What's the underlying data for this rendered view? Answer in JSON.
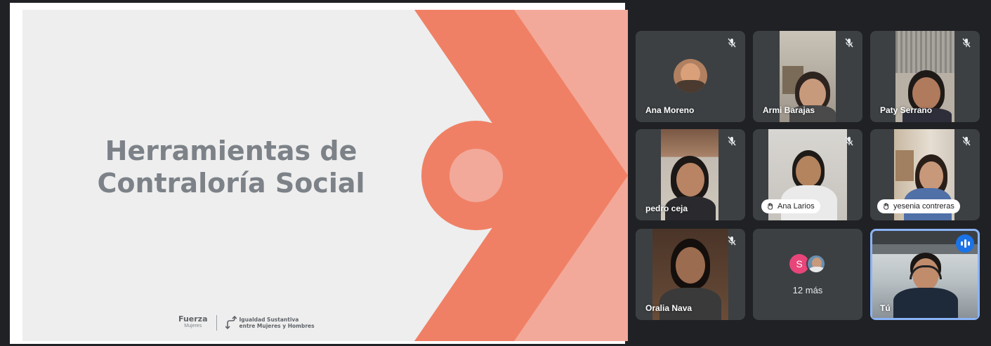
{
  "slide": {
    "title_line1": "Herramientas de",
    "title_line2": "Contraloría Social",
    "footer": {
      "logo1_main": "Fuerza",
      "logo1_sub": "Mujeres",
      "logo2_line1": "Igualdad Sustantiva",
      "logo2_line2": "entre Mujeres y Hombres"
    }
  },
  "participants": [
    {
      "name": "Ana Moreno",
      "muted": true
    },
    {
      "name": "Armi Barajas",
      "muted": true
    },
    {
      "name": "Paty Serrano",
      "muted": true
    },
    {
      "name": "pedro ceja",
      "muted": true
    },
    {
      "name": "Ana Larios",
      "muted": true,
      "hand_raised": true
    },
    {
      "name": "yesenia contreras",
      "muted": true,
      "hand_raised": true
    },
    {
      "name": "Oralia Nava",
      "muted": true
    },
    {
      "more_initial": "S",
      "more_label": "12 más"
    },
    {
      "name": "Tú",
      "speaking": true
    }
  ],
  "colors": {
    "background": "#202124",
    "tile": "#3c4043",
    "slide_bg": "#eeeeee",
    "slide_title": "#7c8288",
    "accent_coral": "#f08065",
    "accent_light": "#f2a99a",
    "speaking_blue": "#1a73e8"
  },
  "icons": {
    "mute": "mic-off-icon",
    "hand": "raised-hand-icon",
    "speaking": "audio-level-icon"
  }
}
